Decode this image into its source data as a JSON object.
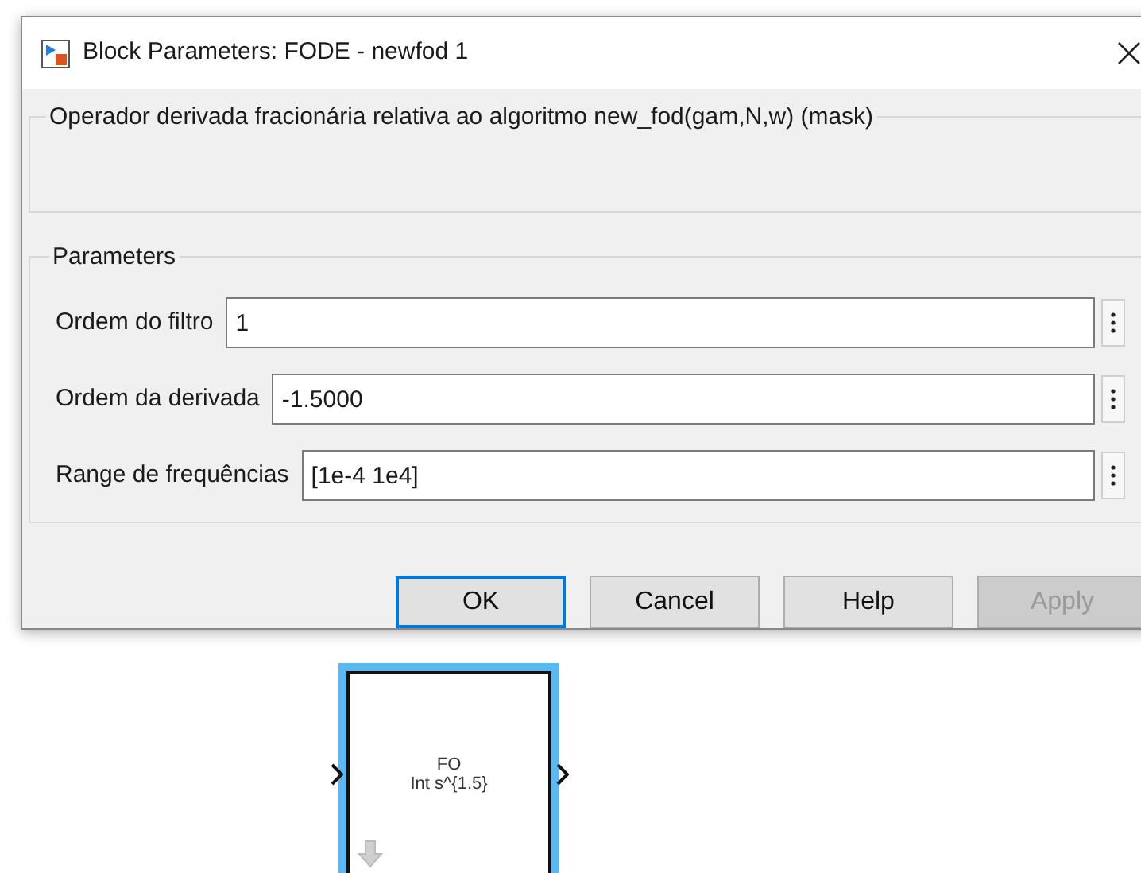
{
  "window": {
    "title": "Block Parameters: FODE - newfod 1"
  },
  "description": {
    "title": "Operador derivada fracionária relativa ao algoritmo new_fod(gam,N,w) (mask)"
  },
  "parameters": {
    "title": "Parameters",
    "fields": [
      {
        "label": "Ordem do filtro",
        "value": "1"
      },
      {
        "label": "Ordem da derivada",
        "value": "-1.5000"
      },
      {
        "label": "Range de frequências",
        "value": "[1e-4 1e4]"
      }
    ]
  },
  "buttons": [
    {
      "label": "OK",
      "default": true,
      "disabled": false
    },
    {
      "label": "Cancel",
      "default": false,
      "disabled": false
    },
    {
      "label": "Help",
      "default": false,
      "disabled": false
    },
    {
      "label": "Apply",
      "default": false,
      "disabled": true
    }
  ],
  "block": {
    "selected": true,
    "lines": [
      "FO",
      "Int s^{1.5}"
    ]
  }
}
